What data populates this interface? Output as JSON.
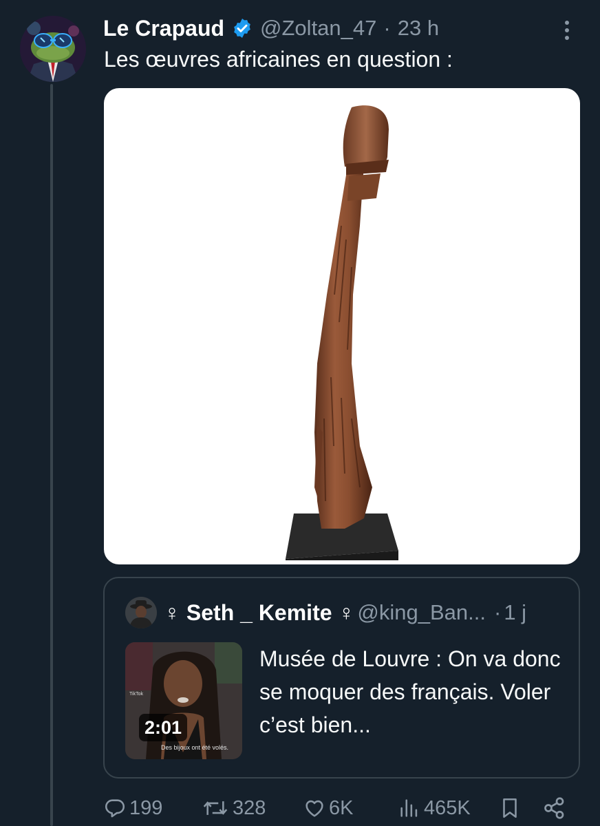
{
  "tweet": {
    "author": {
      "display_name": "Le Crapaud",
      "handle": "@Zoltan_47",
      "time": "23 h",
      "avatar_icon": "frog-with-sunglasses-avatar",
      "verified": true
    },
    "separator": "·",
    "text": "Les œuvres africaines en question :",
    "media": {
      "description_icon": "wooden-sculpture-image"
    },
    "quote": {
      "display_name": "♀ Seth _ Kemite ♀",
      "handle": "@king_Ban...",
      "time": "1 j",
      "text": "Musée de Louvre : On va donc se moquer des français. Voler c’est bien...",
      "video": {
        "duration": "2:01",
        "caption": "Des bijoux ont été volés.",
        "watermark": "TikTok"
      }
    },
    "actions": {
      "replies": "199",
      "reposts": "328",
      "likes": "6K",
      "views": "465K"
    }
  },
  "colors": {
    "background": "#15202b",
    "text_primary": "#ffffff",
    "text_secondary": "#8b98a5",
    "border": "#38444d",
    "verified_blue": "#1d9bf0"
  }
}
